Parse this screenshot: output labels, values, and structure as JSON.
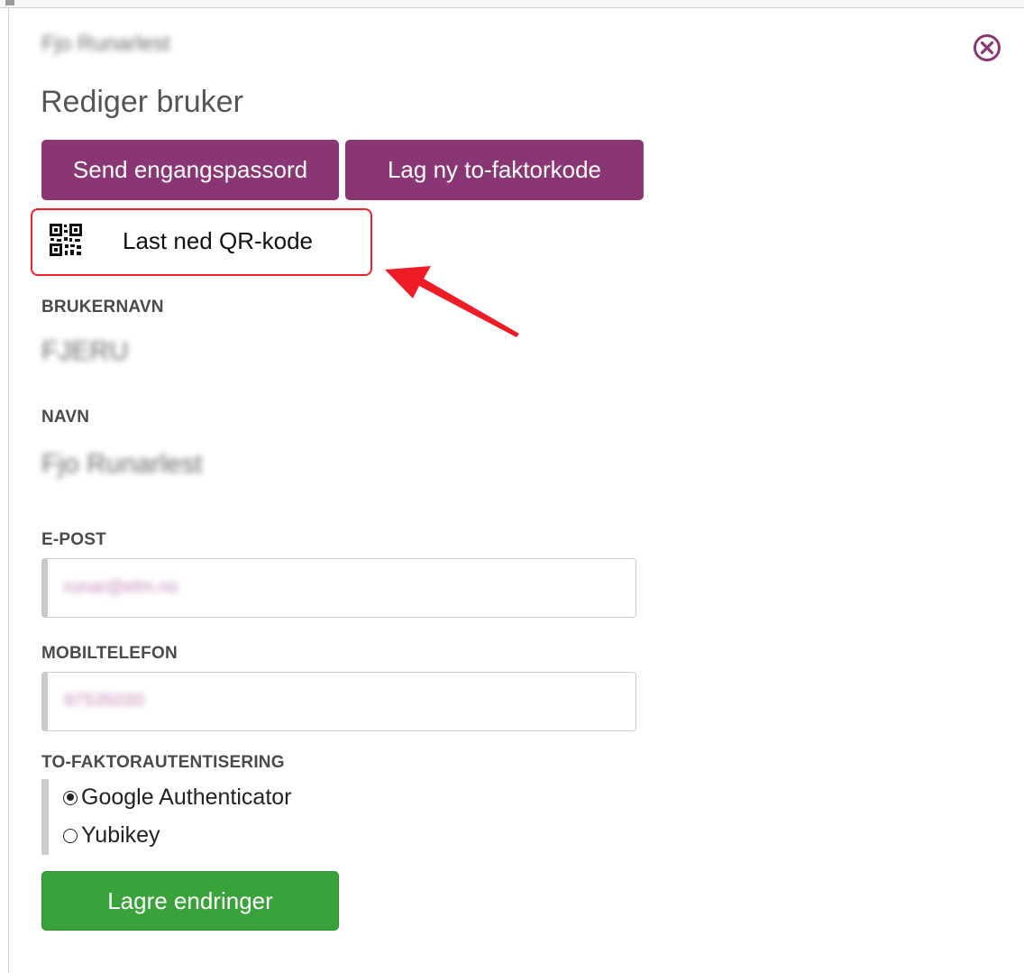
{
  "header": {
    "org_name": "Fjo Runarlest",
    "close_icon": "close-circle-icon",
    "title": "Rediger bruker"
  },
  "actions": {
    "send_otp_label": "Send engangspassord",
    "new_2fa_label": "Lag ny to-faktorkode",
    "qr_download_label": "Last ned QR-kode",
    "qr_icon": "qr-code-icon"
  },
  "annotation": {
    "highlight_color": "#f0202b",
    "arrow_icon": "red-arrow-icon"
  },
  "fields": {
    "username_label": "BRUKERNAVN",
    "username_value": "FJERU",
    "name_label": "NAVN",
    "name_value": "Fjo Runarlest",
    "email_label": "E-POST",
    "email_value": "runar@elm.no",
    "mobile_label": "MOBILTELEFON",
    "mobile_value": "97535030"
  },
  "two_factor": {
    "label": "TO-FAKTORAUTENTISERING",
    "options": [
      {
        "label": "Google Authenticator",
        "checked": true
      },
      {
        "label": "Yubikey",
        "checked": false
      }
    ]
  },
  "save_label": "Lagre endringer",
  "colors": {
    "primary_purple": "#8b3674",
    "save_green": "#3aa23a"
  }
}
